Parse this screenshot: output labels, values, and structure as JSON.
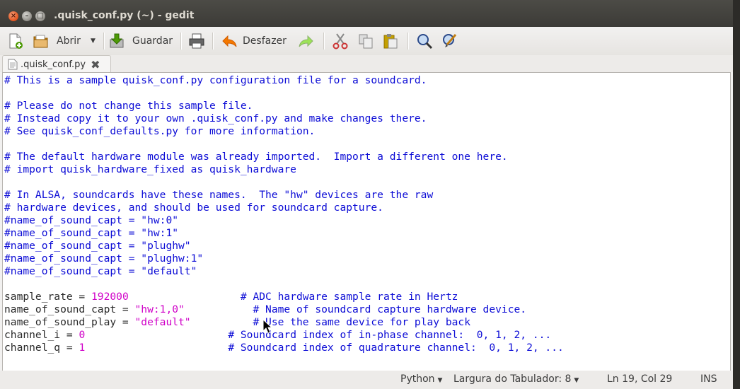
{
  "window": {
    "title": ".quisk_conf.py (~) - gedit"
  },
  "toolbar": {
    "open_label": "Abrir",
    "save_label": "Guardar",
    "undo_label": "Desfazer"
  },
  "tab": {
    "label": ".quisk_conf.py"
  },
  "editor": {
    "lines": [
      [
        {
          "t": "# This is a sample quisk_conf.py configuration file for a soundcard.",
          "c": "c"
        }
      ],
      [],
      [
        {
          "t": "# Please do not change this sample file.",
          "c": "c"
        }
      ],
      [
        {
          "t": "# Instead copy it to your own .quisk_conf.py and make changes there.",
          "c": "c"
        }
      ],
      [
        {
          "t": "# See quisk_conf_defaults.py for more information.",
          "c": "c"
        }
      ],
      [],
      [
        {
          "t": "# The default hardware module was already imported.  Import a different one here.",
          "c": "c"
        }
      ],
      [
        {
          "t": "# import quisk_hardware_fixed as quisk_hardware",
          "c": "c"
        }
      ],
      [],
      [
        {
          "t": "# In ALSA, soundcards have these names.  The \"hw\" devices are the raw",
          "c": "c"
        }
      ],
      [
        {
          "t": "# hardware devices, and should be used for soundcard capture.",
          "c": "c"
        }
      ],
      [
        {
          "t": "#name_of_sound_capt = \"hw:0\"",
          "c": "c"
        }
      ],
      [
        {
          "t": "#name_of_sound_capt = \"hw:1\"",
          "c": "c"
        }
      ],
      [
        {
          "t": "#name_of_sound_capt = \"plughw\"",
          "c": "c"
        }
      ],
      [
        {
          "t": "#name_of_sound_capt = \"plughw:1\"",
          "c": "c"
        }
      ],
      [
        {
          "t": "#name_of_sound_capt = \"default\"",
          "c": "c"
        }
      ],
      [],
      [
        {
          "t": "sample_rate = ",
          "c": "p"
        },
        {
          "t": "192000",
          "c": "n"
        },
        {
          "t": "                  ",
          "c": "p"
        },
        {
          "t": "# ADC hardware sample rate in Hertz",
          "c": "c"
        }
      ],
      [
        {
          "t": "name_of_sound_capt = ",
          "c": "p"
        },
        {
          "t": "\"hw:1,0\"",
          "c": "s"
        },
        {
          "t": "           ",
          "c": "p"
        },
        {
          "t": "# Name of soundcard capture hardware device.",
          "c": "c"
        }
      ],
      [
        {
          "t": "name_of_sound_play = ",
          "c": "p"
        },
        {
          "t": "\"default\"",
          "c": "s"
        },
        {
          "t": "          ",
          "c": "p"
        },
        {
          "t": "# Use the same device for play back",
          "c": "c"
        }
      ],
      [
        {
          "t": "channel_i = ",
          "c": "p"
        },
        {
          "t": "0",
          "c": "n"
        },
        {
          "t": "                       ",
          "c": "p"
        },
        {
          "t": "# Soundcard index of in-phase channel:  0, 1, 2, ...",
          "c": "c"
        }
      ],
      [
        {
          "t": "channel_q = ",
          "c": "p"
        },
        {
          "t": "1",
          "c": "n"
        },
        {
          "t": "                       ",
          "c": "p"
        },
        {
          "t": "# Soundcard index of quadrature channel:  0, 1, 2, ...",
          "c": "c"
        }
      ]
    ]
  },
  "statusbar": {
    "language": "Python",
    "tab_width": "Largura do Tabulador: 8",
    "position": "Ln 19, Col 29",
    "mode": "INS"
  },
  "colors": {
    "comment": "#0d0dd6",
    "string": "#d000c8",
    "titlebar": "#3c3b37"
  },
  "icons": [
    "new-document-icon",
    "open-folder-icon",
    "save-icon",
    "print-icon",
    "undo-icon",
    "redo-icon",
    "cut-icon",
    "copy-icon",
    "paste-icon",
    "search-icon",
    "replace-icon"
  ]
}
